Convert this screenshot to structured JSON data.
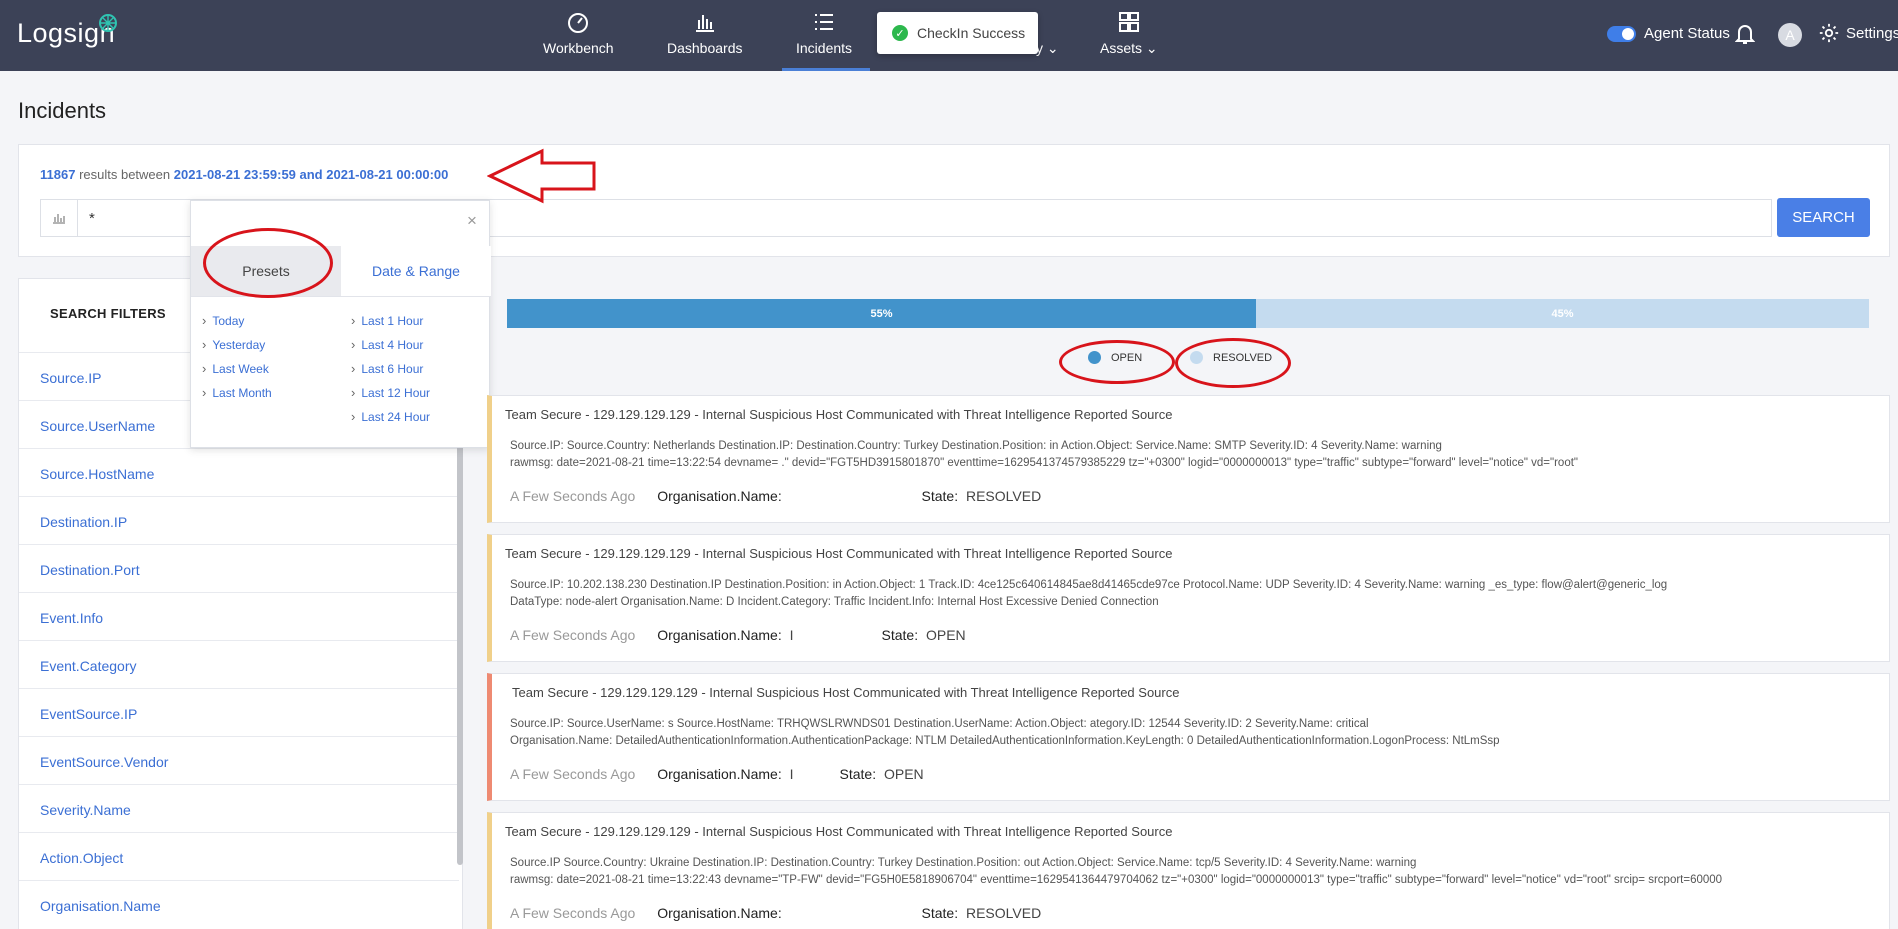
{
  "header": {
    "logo": "Logsign",
    "nav": [
      {
        "label": "Workbench",
        "icon": "gauge-icon"
      },
      {
        "label": "Dashboards",
        "icon": "bar-chart-icon"
      },
      {
        "label": "Incidents",
        "icon": "list-icon"
      },
      {
        "label": "y",
        "icon": "shield-icon"
      },
      {
        "label": "Assets",
        "icon": "grid-icon"
      }
    ],
    "agent_status_label": "Agent Status",
    "avatar_letter": "A",
    "settings_label": "Settings"
  },
  "toast": {
    "message": "CheckIn Success"
  },
  "page": {
    "title": "Incidents"
  },
  "results": {
    "count": "11867",
    "between_text": "results between",
    "range_text": "2021-08-21 23:59:59 and 2021-08-21 00:00:00"
  },
  "search": {
    "query": "*",
    "button_label": "SEARCH"
  },
  "date_picker": {
    "tabs": [
      "Presets",
      "Date & Range"
    ],
    "presets_left": [
      "Today",
      "Yesterday",
      "Last Week",
      "Last Month"
    ],
    "presets_right": [
      "Last 1 Hour",
      "Last 4 Hour",
      "Last 6 Hour",
      "Last 12 Hour",
      "Last 24 Hour"
    ]
  },
  "filters": {
    "title": "SEARCH FILTERS",
    "items": [
      "Source.IP",
      "Source.UserName",
      "Source.HostName",
      "Destination.IP",
      "Destination.Port",
      "Event.Info",
      "Event.Category",
      "EventSource.IP",
      "EventSource.Vendor",
      "Severity.Name",
      "Action.Object",
      "Organisation.Name"
    ]
  },
  "state_distribution": {
    "open_percent": 55,
    "resolved_percent": 45,
    "open_label": "55%",
    "resolved_label": "45%",
    "legend_open": "OPEN",
    "legend_resolved": "RESOLVED",
    "color_open": "#4293cb",
    "color_resolved": "#c4dbef"
  },
  "incidents": [
    {
      "title": "Team Secure - 129.129.129.129 - Internal Suspicious Host Communicated with Threat Intelligence Reported Source",
      "line1": "Source.IP:                    Source.Country: Netherlands  Destination.IP:                                    Destination.Country: Turkey  Destination.Position: in  Action.Object:                     Service.Name: SMTP  Severity.ID: 4  Severity.Name: warning",
      "line2": "rawmsg: date=2021-08-21 time=13:22:54 devname=                                            .\" devid=\"FGT5HD3915801870\" eventtime=1629541374579385229 tz=\"+0300\" logid=\"0000000013\" type=\"traffic\" subtype=\"forward\" level=\"notice\" vd=\"root\"",
      "time": "A Few Seconds Ago",
      "org_label": "Organisation.Name:",
      "org_value": "",
      "state_label": "State:",
      "state_value": "RESOLVED",
      "border_color": "#f0d08a"
    },
    {
      "title": "Team Secure - 129.129.129.129 - Internal Suspicious Host Communicated with Threat Intelligence Reported Source",
      "line1": "Source.IP: 10.202.138.230  Destination.IP                     Destination.Position: in  Action.Object: 1                Track.ID: 4ce125c640614845ae8d41465cde97ce  Protocol.Name: UDP  Severity.ID: 4  Severity.Name: warning  _es_type: flow@alert@generic_log",
      "line2": "DataType: node-alert  Organisation.Name: D                     Incident.Category: Traffic  Incident.Info: Internal Host Excessive Denied Connection",
      "time": "A Few Seconds Ago",
      "org_label": "Organisation.Name:",
      "org_value": "I",
      "state_label": "State:",
      "state_value": "OPEN",
      "border_color": "#f0d08a"
    },
    {
      "title": "Team Secure - 129.129.129.129 - Internal Suspicious Host Communicated with Threat Intelligence Reported Source",
      "line1": "Source.IP:                     Source.UserName: s                      Source.HostName: TRHQWSLRWNDS01  Destination.UserName:                                  Action.Object:                          ategory.ID: 12544  Severity.ID: 2  Severity.Name: critical",
      "line2": "Organisation.Name:            DetailedAuthenticationInformation.AuthenticationPackage: NTLM  DetailedAuthenticationInformation.KeyLength: 0  DetailedAuthenticationInformation.LogonProcess: NtLmSsp",
      "time": "A Few Seconds Ago",
      "org_label": "Organisation.Name:",
      "org_value": "I",
      "state_label": "State:",
      "state_value": "OPEN",
      "border_color": "#ee8a72"
    },
    {
      "title": "Team Secure - 129.129.129.129 - Internal Suspicious Host Communicated with Threat Intelligence Reported Source",
      "line1": "Source.IP                    Source.Country: Ukraine  Destination.IP:                       Destination.Country: Turkey  Destination.Position: out  Action.Object:                    Service.Name: tcp/5         Severity.ID: 4  Severity.Name: warning",
      "line2": "rawmsg: date=2021-08-21 time=13:22:43 devname=\"TP-FW\" devid=\"FG5H0E5818906704\" eventtime=1629541364479704062 tz=\"+0300\" logid=\"0000000013\" type=\"traffic\" subtype=\"forward\" level=\"notice\" vd=\"root\" srcip=                      srcport=60000",
      "time": "A Few Seconds Ago",
      "org_label": "Organisation.Name:",
      "org_value": "",
      "state_label": "State:",
      "state_value": "RESOLVED",
      "border_color": "#f0d08a"
    }
  ]
}
